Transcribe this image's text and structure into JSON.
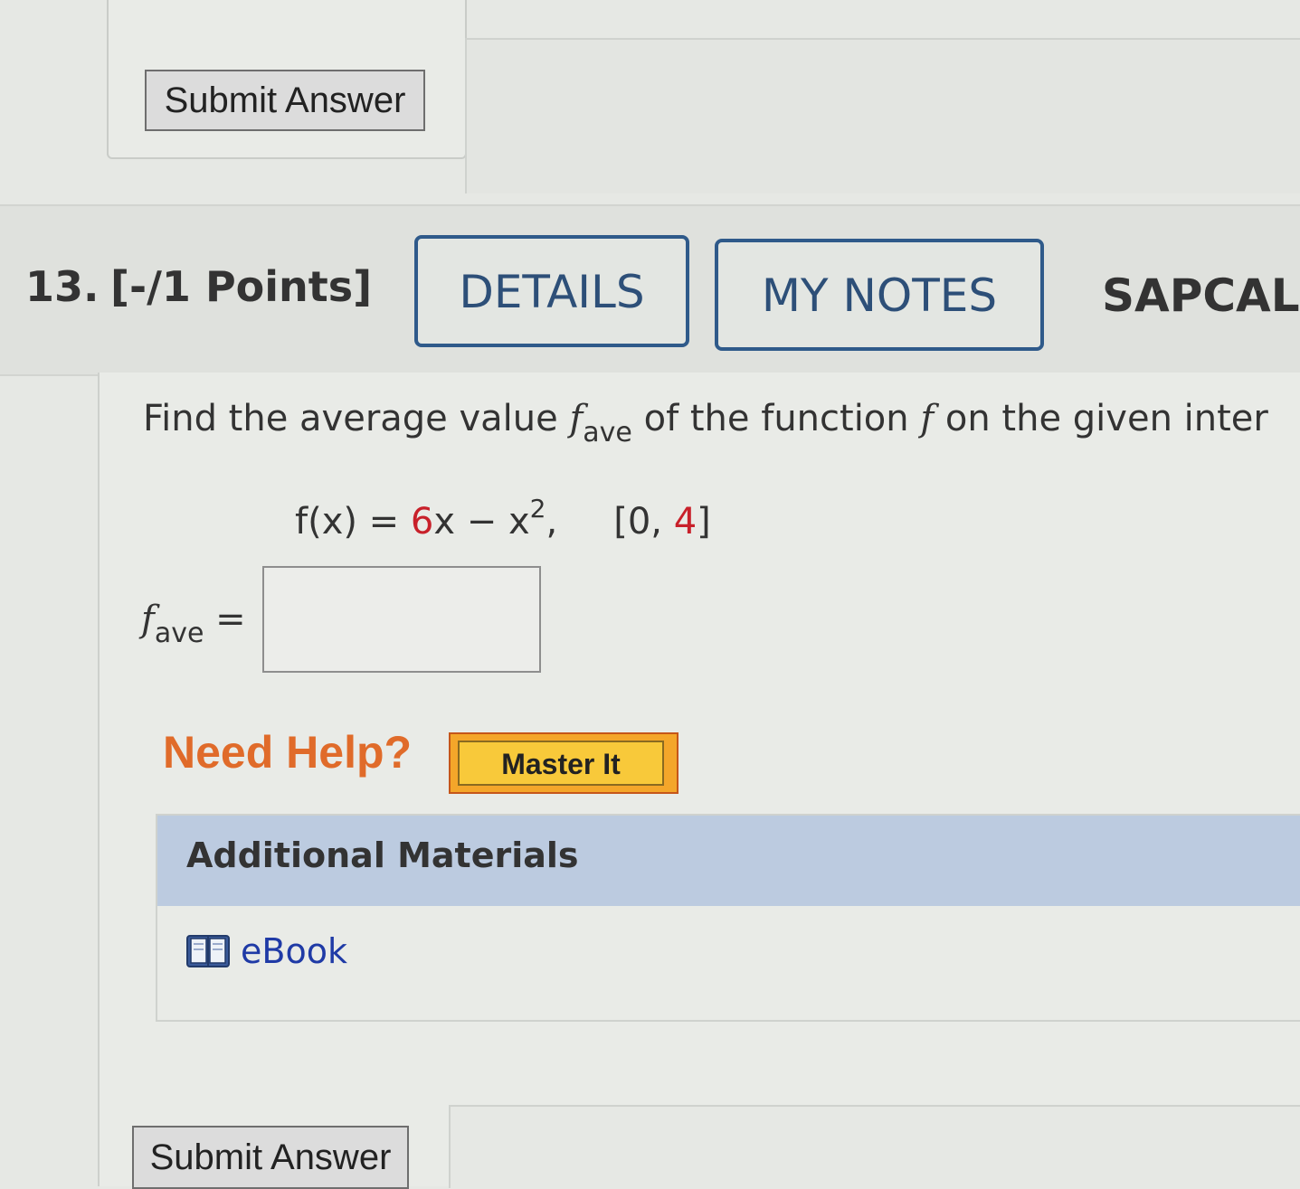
{
  "top_section": {
    "submit_label": "Submit Answer"
  },
  "question": {
    "number": "13.",
    "points": "[-/1 Points]",
    "details_label": "DETAILS",
    "notes_label": "MY NOTES",
    "course_code": "SAPCALC",
    "prompt_part1": "Find the average value ",
    "prompt_f": "f",
    "prompt_sub": "ave",
    "prompt_part2": " of the function ",
    "prompt_f2": "f",
    "prompt_part3": " on the given inter",
    "equation_lhs": "f(x) = ",
    "equation_coef": "6",
    "equation_mid": "x − x",
    "equation_exp": "2",
    "equation_comma": ",",
    "interval_open": "[0, ",
    "interval_end": "4",
    "interval_close": "]",
    "answer_f": "f",
    "answer_sub": "ave",
    "answer_eq": " =",
    "answer_value": ""
  },
  "help": {
    "label": "Need Help?",
    "master_label": "Master It"
  },
  "materials": {
    "title": "Additional Materials",
    "ebook_label": "eBook",
    "ebook_icon": "book-icon"
  },
  "bottom_section": {
    "submit_label": "Submit Answer"
  },
  "colors": {
    "accent_blue": "#2f5a8a",
    "help_orange": "#e06b2a",
    "master_yellow": "#f8c93a",
    "highlight_red": "#c8202a",
    "link_blue": "#1f3aa6",
    "materials_header": "#bccbe0"
  }
}
